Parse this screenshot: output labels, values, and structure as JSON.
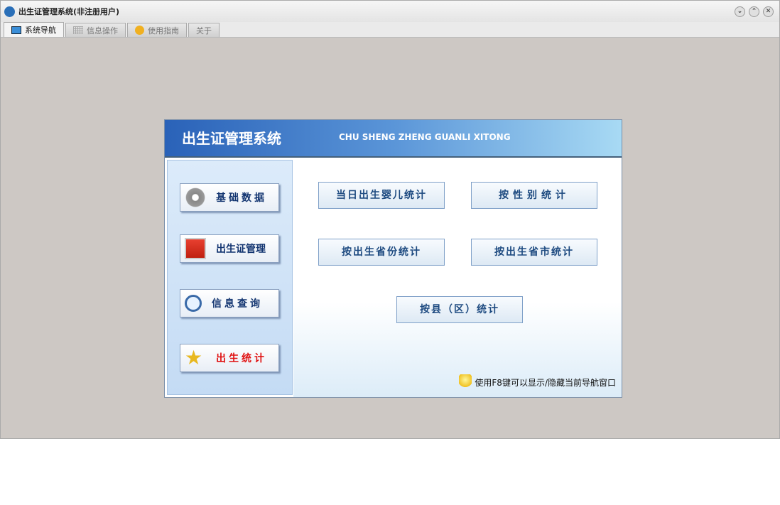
{
  "window": {
    "title": "出生证管理系统(非注册用户)",
    "controls": [
      "⌄",
      "⌃",
      "✕"
    ]
  },
  "tabs": [
    {
      "label": "系统导航"
    },
    {
      "label": "信息操作"
    },
    {
      "label": "使用指南"
    },
    {
      "label": "关于"
    }
  ],
  "banner": {
    "title": "出生证管理系统",
    "subtitle": "CHU SHENG ZHENG GUANLI XITONG"
  },
  "nav": [
    {
      "label": "基础数据"
    },
    {
      "label": "出生证管理"
    },
    {
      "label": "信息查询"
    },
    {
      "label": "出生统计",
      "color": "#e01010"
    }
  ],
  "stats": [
    {
      "label": "当日出生婴儿统计"
    },
    {
      "label": "按性别统计"
    },
    {
      "label": "按出生省份统计"
    },
    {
      "label": "按出生省市统计"
    },
    {
      "label": "按县（区）统计"
    }
  ],
  "tip": "使用F8键可以显示/隐藏当前导航窗口"
}
